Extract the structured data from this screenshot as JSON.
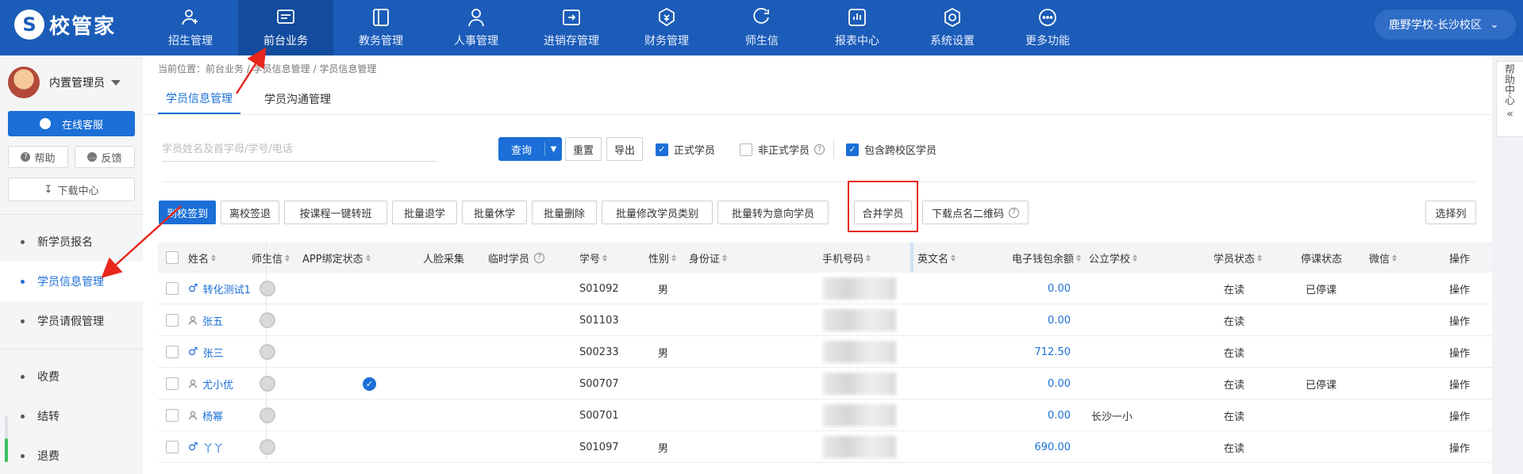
{
  "app": {
    "logo_text": "校管家"
  },
  "nav": {
    "items": [
      {
        "label": "招生管理",
        "icon": "user-plus-icon"
      },
      {
        "label": "前台业务",
        "icon": "reception-icon",
        "active": true
      },
      {
        "label": "教务管理",
        "icon": "book-icon"
      },
      {
        "label": "人事管理",
        "icon": "person-icon"
      },
      {
        "label": "进销存管理",
        "icon": "inventory-icon"
      },
      {
        "label": "财务管理",
        "icon": "finance-icon"
      },
      {
        "label": "师生信",
        "icon": "message-icon"
      },
      {
        "label": "报表中心",
        "icon": "report-icon"
      },
      {
        "label": "系统设置",
        "icon": "settings-icon"
      },
      {
        "label": "更多功能",
        "icon": "more-icon"
      }
    ],
    "school": "鹿野学校-长沙校区"
  },
  "sidebar": {
    "user_name": "内置管理员",
    "online_service": "在线客服",
    "help": "帮助",
    "feedback": "反馈",
    "download_center": "下载中心",
    "items": [
      {
        "label": "新学员报名"
      },
      {
        "label": "学员信息管理",
        "active": true
      },
      {
        "label": "学员请假管理"
      },
      {
        "label": "收费"
      },
      {
        "label": "结转"
      },
      {
        "label": "退费"
      }
    ]
  },
  "main": {
    "breadcrumb": "当前位置：前台业务 / 学员信息管理 / 学员信息管理",
    "tabs": [
      {
        "label": "学员信息管理",
        "active": true
      },
      {
        "label": "学员沟通管理"
      }
    ],
    "search_placeholder": "学员姓名及首字母/学号/电话",
    "query": "查询",
    "reset": "重置",
    "export": "导出",
    "filters": {
      "official": {
        "label": "正式学员",
        "checked": true
      },
      "unofficial": {
        "label": "非正式学员",
        "checked": false
      },
      "cross_campus": {
        "label": "包含跨校区学员",
        "checked": true
      }
    },
    "actions": {
      "checkin": "到校签到",
      "checkout": "离校签退",
      "transfer": "按课程一键转班",
      "batch_withdraw": "批量退学",
      "batch_suspend": "批量休学",
      "batch_delete": "批量删除",
      "batch_category": "批量修改学员类别",
      "batch_intent": "批量转为意向学员",
      "merge": "合并学员",
      "qrcode": "下载点名二维码",
      "select_columns": "选择列"
    },
    "columns": {
      "name": "姓名",
      "wechat_teacher": "师生信",
      "app_status": "APP绑定状态",
      "face": "人脸采集",
      "temp": "临时学员",
      "student_no": "学号",
      "gender": "性别",
      "id_card": "身份证",
      "phone": "手机号码",
      "english_name": "英文名",
      "wallet": "电子钱包余额",
      "public_school": "公立学校",
      "status": "学员状态",
      "suspend": "停课状态",
      "wechat": "微信",
      "ops": "操作"
    },
    "rows": [
      {
        "name": "转化测试1",
        "gender_icon": "male",
        "app_bound": false,
        "no": "S01092",
        "gender": "男",
        "wallet": "0.00",
        "school": "",
        "status": "在读",
        "suspend": "已停课",
        "op": "操作"
      },
      {
        "name": "张五",
        "gender_icon": "none",
        "app_bound": false,
        "no": "S01103",
        "gender": "",
        "wallet": "0.00",
        "school": "",
        "status": "在读",
        "suspend": "",
        "op": "操作"
      },
      {
        "name": "张三",
        "gender_icon": "male",
        "app_bound": false,
        "no": "S00233",
        "gender": "男",
        "wallet": "712.50",
        "school": "",
        "status": "在读",
        "suspend": "",
        "op": "操作"
      },
      {
        "name": "尤小优",
        "gender_icon": "none",
        "app_bound": true,
        "no": "S00707",
        "gender": "",
        "wallet": "0.00",
        "school": "",
        "status": "在读",
        "suspend": "已停课",
        "op": "操作"
      },
      {
        "name": "杨幂",
        "gender_icon": "none",
        "app_bound": false,
        "no": "S00701",
        "gender": "",
        "wallet": "0.00",
        "school": "长沙一小",
        "status": "在读",
        "suspend": "",
        "op": "操作"
      },
      {
        "name": "丫丫",
        "gender_icon": "male",
        "app_bound": false,
        "no": "S01097",
        "gender": "男",
        "wallet": "690.00",
        "school": "",
        "status": "在读",
        "suspend": "",
        "op": "操作"
      }
    ]
  },
  "help_panel": {
    "label": "帮助中心",
    "chars": [
      "帮",
      "助",
      "中",
      "心"
    ]
  },
  "colors": {
    "primary": "#1b6fd6",
    "topbar": "#1b5cb8",
    "annotation": "#e8261c"
  }
}
